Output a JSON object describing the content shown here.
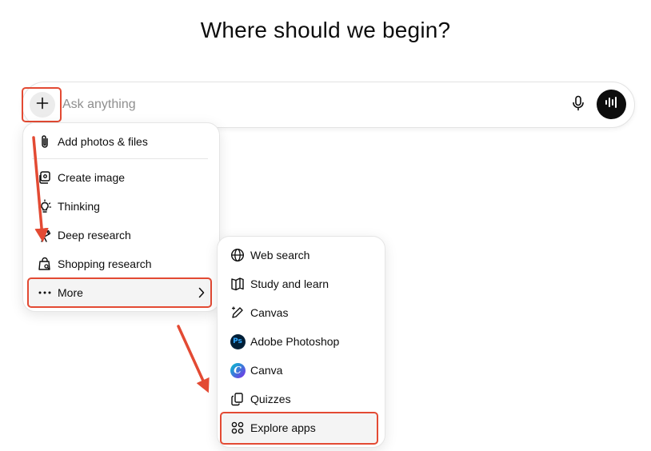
{
  "page": {
    "title": "Where should we begin?"
  },
  "composer": {
    "placeholder": "Ask anything",
    "plus_icon": "plus-icon",
    "mic_icon": "microphone-icon",
    "voice_icon": "voice-waveform-icon"
  },
  "menu": {
    "items": [
      {
        "label": "Add photos & files",
        "icon": "paperclip-icon"
      },
      {
        "label": "Create image",
        "icon": "image-icon"
      },
      {
        "label": "Thinking",
        "icon": "lightbulb-icon"
      },
      {
        "label": "Deep research",
        "icon": "telescope-icon"
      },
      {
        "label": "Shopping research",
        "icon": "shopping-bag-icon"
      },
      {
        "label": "More",
        "icon": "ellipsis-icon",
        "has_submenu": true
      }
    ]
  },
  "submenu": {
    "items": [
      {
        "label": "Web search",
        "icon": "globe-icon"
      },
      {
        "label": "Study and learn",
        "icon": "book-icon"
      },
      {
        "label": "Canvas",
        "icon": "pen-sparkle-icon"
      },
      {
        "label": "Adobe Photoshop",
        "icon": "photoshop-logo-icon",
        "badge": "Ps"
      },
      {
        "label": "Canva",
        "icon": "canva-logo-icon",
        "badge": "C"
      },
      {
        "label": "Quizzes",
        "icon": "cards-icon"
      },
      {
        "label": "Explore apps",
        "icon": "grid-icon"
      }
    ]
  },
  "annotation": {
    "color": "#e34a33"
  }
}
